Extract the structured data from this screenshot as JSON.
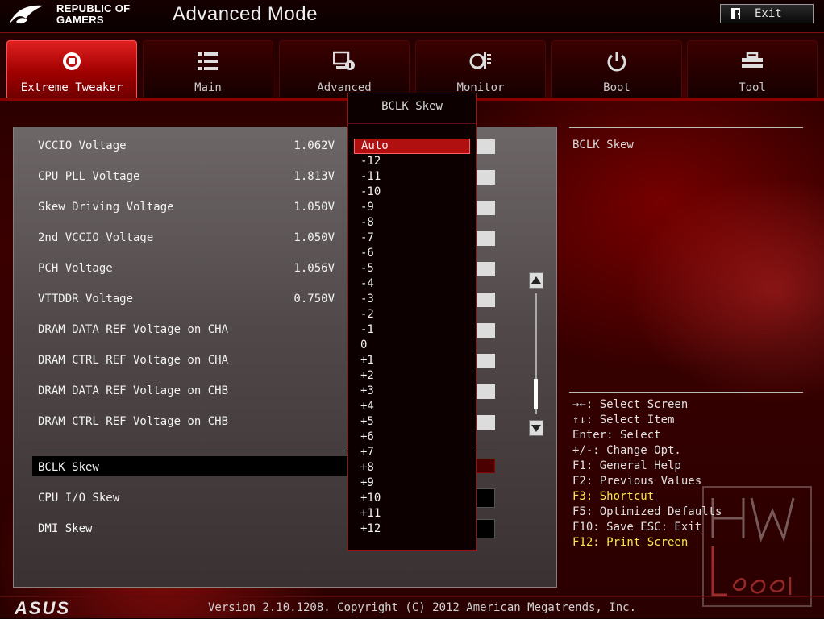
{
  "header": {
    "brand_line1": "REPUBLIC OF",
    "brand_line2": "GAMERS",
    "mode_title": "Advanced Mode",
    "exit_label": "Exit"
  },
  "tabs": [
    {
      "label": "Extreme Tweaker",
      "icon": "tweaker-icon",
      "active": true
    },
    {
      "label": "Main",
      "icon": "list-icon",
      "active": false
    },
    {
      "label": "Advanced",
      "icon": "advanced-icon",
      "active": false
    },
    {
      "label": "Monitor",
      "icon": "monitor-icon",
      "active": false
    },
    {
      "label": "Boot",
      "icon": "power-icon",
      "active": false
    },
    {
      "label": "Tool",
      "icon": "tool-icon",
      "active": false
    }
  ],
  "settings": [
    {
      "label": "VCCIO Voltage",
      "value": "1.062V"
    },
    {
      "label": "CPU PLL Voltage",
      "value": "1.813V"
    },
    {
      "label": "Skew Driving Voltage",
      "value": "1.050V"
    },
    {
      "label": "2nd VCCIO Voltage",
      "value": "1.050V"
    },
    {
      "label": "PCH Voltage",
      "value": "1.056V"
    },
    {
      "label": "VTTDDR Voltage",
      "value": "0.750V"
    },
    {
      "label": "DRAM DATA REF Voltage on CHA",
      "value": ""
    },
    {
      "label": "DRAM CTRL REF Voltage on CHA",
      "value": ""
    },
    {
      "label": "DRAM DATA REF Voltage on CHB",
      "value": ""
    },
    {
      "label": "DRAM CTRL REF Voltage on CHB",
      "value": ""
    }
  ],
  "skew_settings": [
    {
      "label": "BCLK Skew"
    },
    {
      "label": "CPU I/O Skew"
    },
    {
      "label": "DMI Skew"
    }
  ],
  "popup": {
    "title": "BCLK Skew",
    "options": [
      "Auto",
      "-12",
      "-11",
      "-10",
      "-9",
      "-8",
      "-7",
      "-6",
      "-5",
      "-4",
      "-3",
      "-2",
      "-1",
      "0",
      "+1",
      "+2",
      "+3",
      "+4",
      "+5",
      "+6",
      "+7",
      "+8",
      "+9",
      "+10",
      "+11",
      "+12"
    ],
    "selected": "Auto"
  },
  "help": {
    "title": "BCLK Skew",
    "keys": [
      {
        "text": "→←: Select Screen",
        "highlight": false
      },
      {
        "text": "↑↓: Select Item",
        "highlight": false
      },
      {
        "text": "Enter: Select",
        "highlight": false
      },
      {
        "text": "+/-: Change Opt.",
        "highlight": false
      },
      {
        "text": "F1: General Help",
        "highlight": false
      },
      {
        "text": "F2: Previous Values",
        "highlight": false
      },
      {
        "text": "F3: Shortcut",
        "highlight": true
      },
      {
        "text": "F5: Optimized Defaults",
        "highlight": false
      },
      {
        "text": "F10: Save  ESC: Exit",
        "highlight": false
      },
      {
        "text": "F12: Print Screen",
        "highlight": true
      }
    ]
  },
  "footer": {
    "logo": "ASUS",
    "version": "Version 2.10.1208. Copyright (C) 2012 American Megatrends, Inc."
  },
  "colors": {
    "accent": "#b01010",
    "highlight_text": "#f5e84a"
  }
}
